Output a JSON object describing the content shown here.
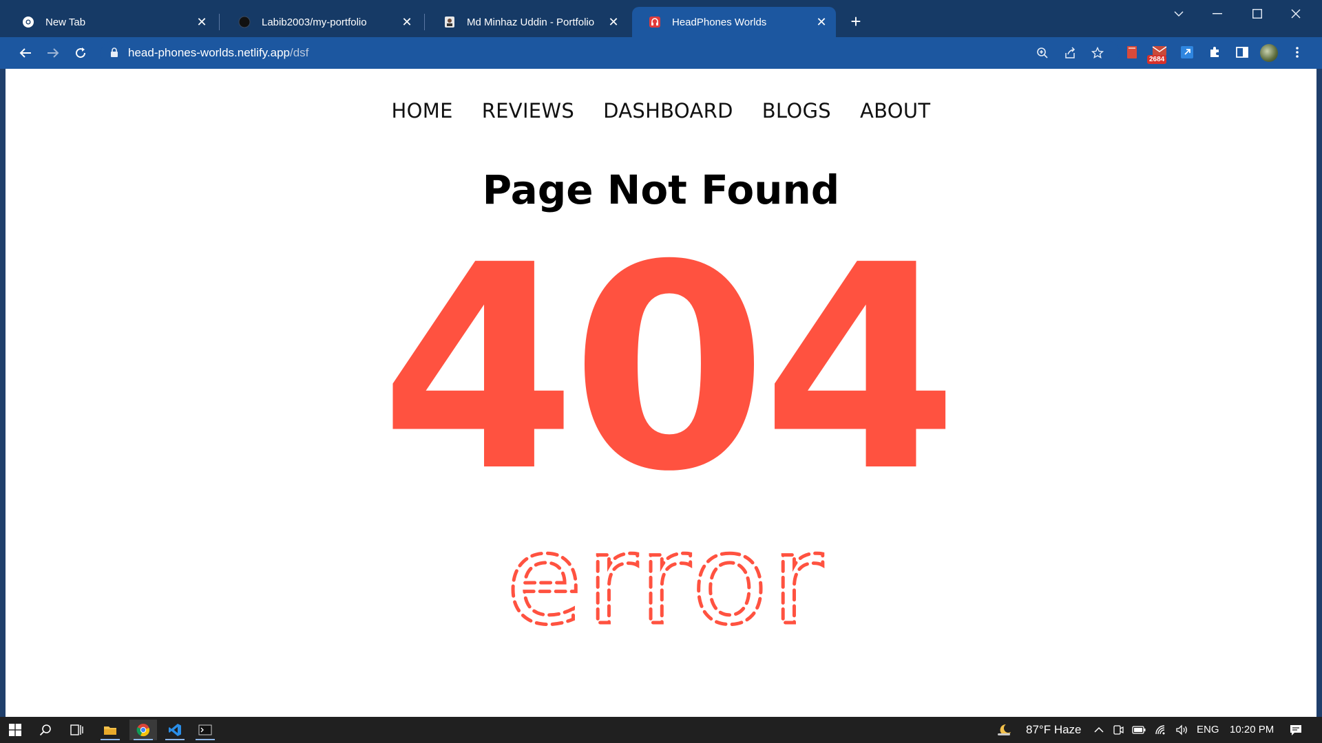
{
  "browser": {
    "tabs": [
      {
        "title": "New Tab",
        "active": false,
        "icon": "chrome-icon"
      },
      {
        "title": "Labib2003/my-portfolio",
        "active": false,
        "icon": "github-icon"
      },
      {
        "title": "Md Minhaz Uddin - Portfolio",
        "active": false,
        "icon": "portfolio-icon"
      },
      {
        "title": "HeadPhones Worlds",
        "active": true,
        "icon": "headphones-icon"
      }
    ],
    "url_host": "head-phones-worlds.netlify.app",
    "url_path": "/dsf",
    "extension_badge": "2684"
  },
  "page": {
    "nav": [
      "HOME",
      "REVIEWS",
      "DASHBOARD",
      "BLOGS",
      "ABOUT"
    ],
    "heading": "Page Not Found",
    "big_code": "404",
    "sub_word": "error",
    "accent_color": "#ff5240"
  },
  "taskbar": {
    "weather": "87°F  Haze",
    "language": "ENG",
    "time": "10:20 PM"
  }
}
